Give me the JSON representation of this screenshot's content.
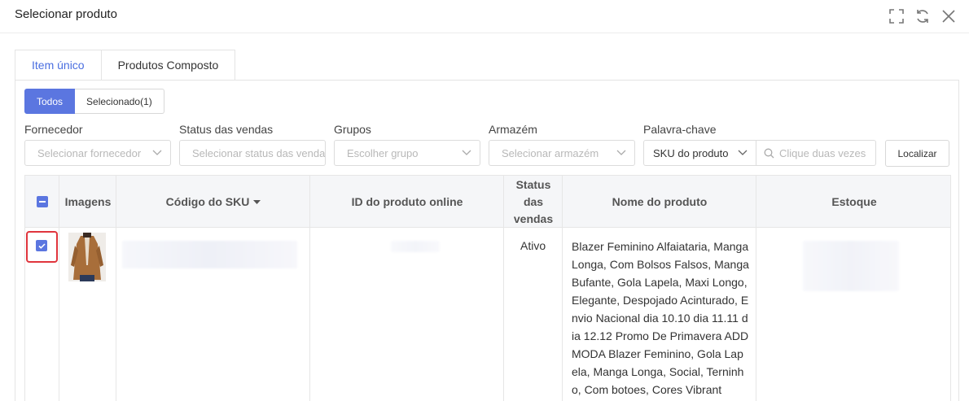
{
  "dialog": {
    "title": "Selecionar produto",
    "icons": [
      "fullscreen-icon",
      "refresh-icon",
      "close-icon"
    ]
  },
  "tabs": [
    {
      "label": "Item único",
      "active": true
    },
    {
      "label": "Produtos Composto",
      "active": false
    }
  ],
  "filter_toggle": {
    "all_label": "Todos",
    "selected_label": "Selecionado(1)"
  },
  "filters": {
    "supplier": {
      "label": "Fornecedor",
      "placeholder": "Selecionar fornecedor"
    },
    "sales_status": {
      "label": "Status das vendas",
      "placeholder": "Selecionar status das vendas"
    },
    "groups": {
      "label": "Grupos",
      "placeholder": "Escolher grupo"
    },
    "warehouse": {
      "label": "Armazém",
      "placeholder": "Selecionar armazém"
    },
    "keyword": {
      "label": "Palavra-chave",
      "type_value": "SKU do produto",
      "placeholder": "Clique duas vezes"
    },
    "search_button": "Localizar"
  },
  "table": {
    "columns": {
      "images": "Imagens",
      "sku_code": "Código do SKU",
      "online_id": "ID do produto online",
      "sales_status": "Status das vendas",
      "product_name": "Nome do produto",
      "stock": "Estoque"
    },
    "rows": [
      {
        "checked": true,
        "sales_status": "Ativo",
        "product_name": "Blazer Feminino Alfaiataria, Manga Longa, Com Bolsos Falsos, Manga Bufante, Gola Lapela, Maxi Longo, Elegante, Despojado Acinturado, Envio Nacional dia 10.10 dia 11.11 dia 12.12 Promo De Primavera ADD MODA Blazer Feminino, Gola Lapela, Manga Longa, Social, Terninho, Com botoes, Cores Vibrant"
      }
    ]
  },
  "colors": {
    "accent": "#5b76e0",
    "highlight": "#e0353d"
  }
}
